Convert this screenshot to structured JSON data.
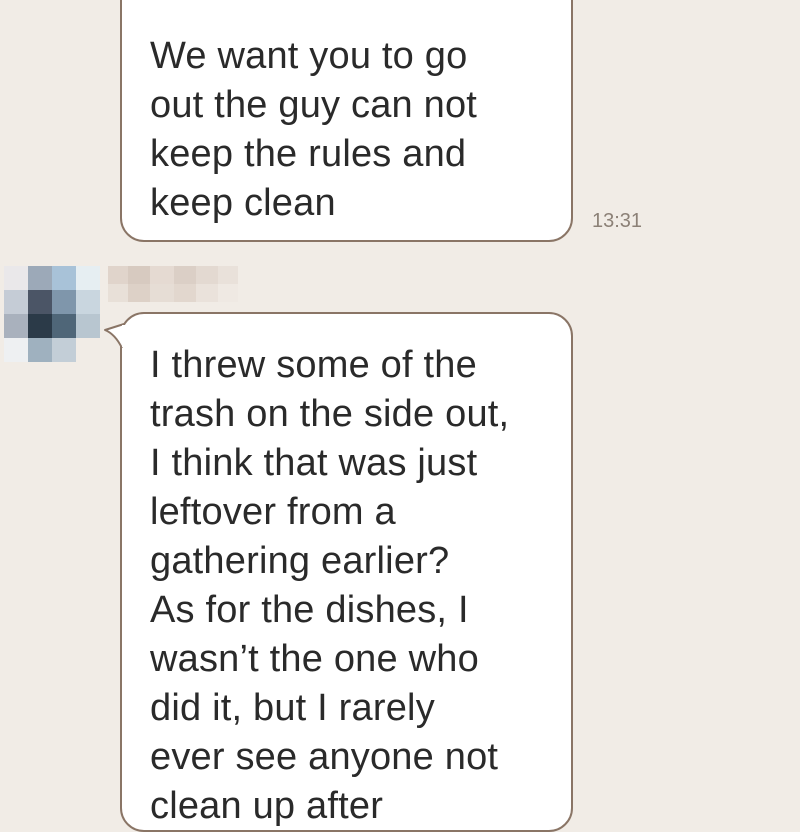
{
  "messages": [
    {
      "lines": [
        "We want you to go",
        "out the guy can not",
        "keep the rules and",
        "keep clean"
      ],
      "time": "13:31"
    },
    {
      "lines": [
        "I threw some of the",
        "trash on the side out,",
        "I think that was just",
        "leftover from a",
        "gathering earlier?",
        "As for the dishes, I",
        "wasn’t the one who",
        "did it, but I rarely",
        "ever see anyone not",
        "clean up after"
      ]
    }
  ],
  "colors": {
    "background": "#f1ece6",
    "bubble_fill": "#ffffff",
    "bubble_border": "#8a7566",
    "text": "#2a2a2a",
    "timestamp": "#8c8177"
  },
  "icons": {
    "avatar": "pixelated-avatar-icon",
    "sender_name": "pixelated-name-placeholder"
  }
}
